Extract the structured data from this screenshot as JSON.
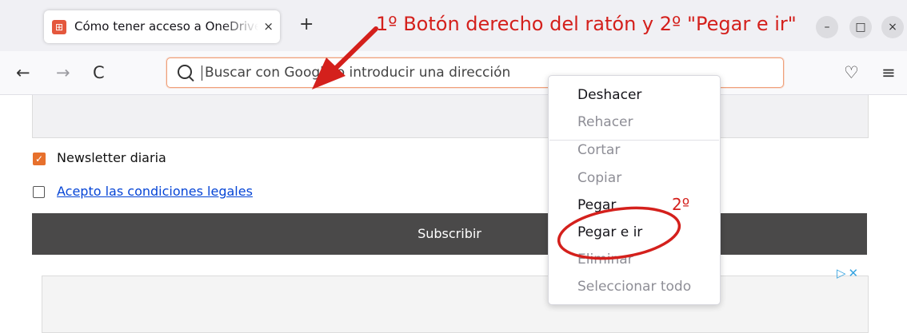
{
  "tab": {
    "title": "Cómo tener acceso a OneDrive",
    "close": "×",
    "new_tab": "+"
  },
  "window_controls": {
    "minimize": "–",
    "maximize": "□",
    "close": "×"
  },
  "nav": {
    "back": "←",
    "forward": "→",
    "reload": "C",
    "pocket": "♡",
    "menu": "≡",
    "url_placeholder": "Buscar con Google o introducir una dirección"
  },
  "form": {
    "newsletter_label": "Newsletter diaria",
    "newsletter_checked": true,
    "terms_label": "Acepto las condiciones legales",
    "terms_checked": false,
    "subscribe_label": "Subscribir"
  },
  "context_menu": {
    "items": [
      {
        "label": "Deshacer",
        "enabled": true
      },
      {
        "label": "Rehacer",
        "enabled": false
      },
      {
        "label": "Cortar",
        "enabled": false
      },
      {
        "label": "Copiar",
        "enabled": false
      },
      {
        "label": "Pegar",
        "enabled": true
      },
      {
        "label": "Pegar e ir",
        "enabled": true
      },
      {
        "label": "Eliminar",
        "enabled": false
      },
      {
        "label": "Seleccionar todo",
        "enabled": false
      }
    ]
  },
  "annotations": {
    "instruction": "1º Botón derecho del ratón y 2º \"Pegar e ir\"",
    "step_two": "2º",
    "color": "#d4201c"
  },
  "ad_icons": "▷✕"
}
